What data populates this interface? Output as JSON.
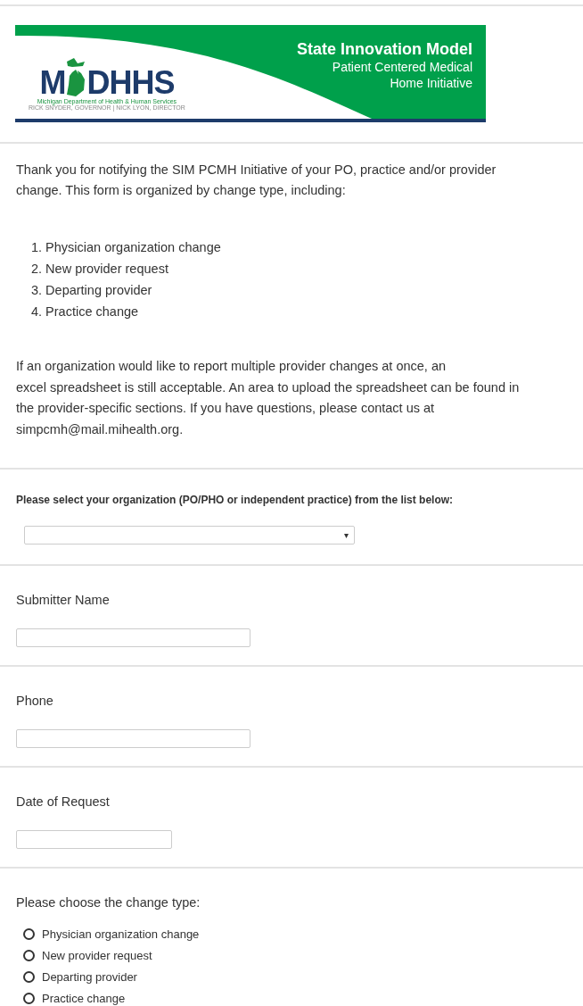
{
  "banner": {
    "logo_left": "M",
    "logo_right": "DHHS",
    "logo_caption": "Michigan Department of Health & Human Services",
    "logo_subcaption": "RICK SNYDER, GOVERNOR | NICK LYON, DIRECTOR",
    "title": "State Innovation Model",
    "subtitle_lines": [
      "Patient Centered Medical",
      "Home Initiative"
    ]
  },
  "intro": "Thank you for notifying the SIM PCMH Initiative of your PO, practice and/or provider change. This form is organized by change type, including:",
  "change_types": [
    {
      "marker": "1.",
      "label": "Physician organization change"
    },
    {
      "marker": "2.",
      "label": "New provider request"
    },
    {
      "marker": "3.",
      "label": "Departing provider"
    },
    {
      "marker": "4.",
      "label": "Practice change"
    }
  ],
  "note_lines": [
    "If an organization would like to report multiple provider changes at once, an",
    "excel spreadsheet is still acceptable. An area to upload the spreadsheet can be found in",
    "the provider-specific sections. If you have questions, please contact us at",
    "simpcmh@mail.mihealth.org."
  ],
  "organization": {
    "label": "Please select your organization (PO/PHO or independent practice) from the list below:",
    "arrow": "▾"
  },
  "fields": [
    {
      "label": "Submitter Name",
      "kind": "text"
    },
    {
      "label": "Phone",
      "kind": "text"
    },
    {
      "label": "Date of Request",
      "kind": "date"
    }
  ],
  "change_type_question": {
    "label": "Please choose the change type:",
    "options": [
      {
        "label": "Physician organization change",
        "selected": false
      },
      {
        "label": "New provider request",
        "selected": false
      },
      {
        "label": "Departing provider",
        "selected": false
      },
      {
        "label": "Practice change",
        "selected": false
      }
    ]
  }
}
